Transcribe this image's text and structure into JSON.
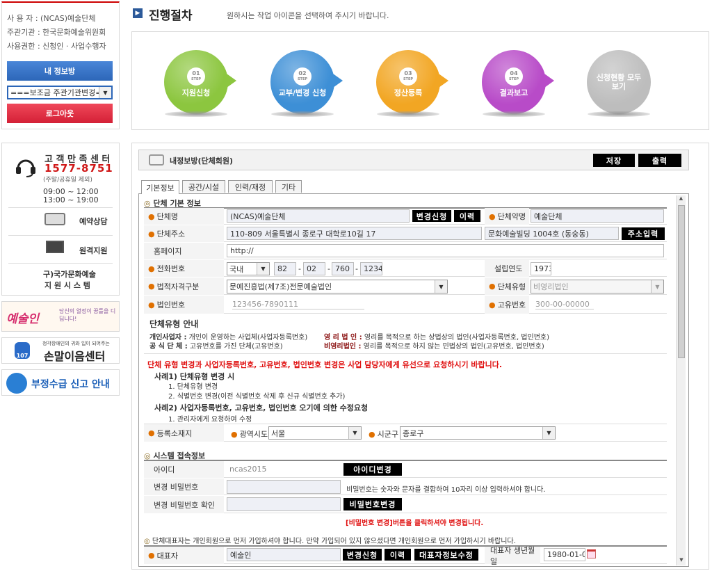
{
  "user": {
    "name_label": "사 용 자 : (NCAS)예술단체",
    "org_label": "주관기관 : 한국문화예술위원회",
    "role_label": "사용권한 : 신청인 · 사업수행자",
    "myinfo_btn": "내 정보방",
    "org_select": "===보조금 주관기관변경===",
    "logout_btn": "로그아웃"
  },
  "support": {
    "title": "고 객 만 족 센 터",
    "phone": "1577-8751",
    "note": "(주말/공휴일 제외)",
    "hours1": "09:00 ~ 12:00",
    "hours2": "13:00 ~ 19:00",
    "reserve": "예약상담",
    "remote": "원격지원",
    "old_sys_1": "구)국가문화예술",
    "old_sys_2": "지 원 시 스 템"
  },
  "banners": {
    "b1": "예술인",
    "b1_sub": "당신의 열정이 꿈틀을 디딥니다!",
    "b2_top": "청각장애인의 귀와 입이 되어주는",
    "b2": "손말이음센터",
    "b2_num": "107",
    "b3": "부정수급 신고 안내"
  },
  "header": {
    "title": "진행절차",
    "subtitle": "원하시는 작업 아이콘을 선택하여 주시기 바랍니다."
  },
  "steps": [
    {
      "num": "01",
      "step": "STEP",
      "label": "지원신청",
      "color": "#8cc63f"
    },
    {
      "num": "02",
      "step": "STEP",
      "label": "교부/변경 신청",
      "color": "#3d8fd6"
    },
    {
      "num": "03",
      "step": "STEP",
      "label": "정산등록",
      "color": "#f2a623"
    },
    {
      "num": "04",
      "step": "STEP",
      "label": "결과보고",
      "color": "#b84bc8"
    },
    {
      "label": "신청현황 모두보기",
      "color": "#bdbdbd"
    }
  ],
  "panel": {
    "title": "내정보방(단체회원)",
    "save": "저장",
    "print": "출력"
  },
  "tabs": [
    "기본정보",
    "공간/시설",
    "인력/재정",
    "기타"
  ],
  "section1": "단체 기본 정보",
  "form": {
    "name_lbl": "단체명",
    "name_val": "(NCAS)예술단체",
    "change_req": "변경신청",
    "history": "이력",
    "abbr_lbl": "단체약명",
    "abbr_val": "예술단체",
    "addr_lbl": "단체주소",
    "addr_val": "110-809  서울특별시 종로구 대학로10길 17",
    "addr2_val": "문화예술빌딩 1004호 (동숭동)",
    "addr_btn": "주소입력",
    "home_lbl": "홈페이지",
    "home_val": "http://",
    "tel_lbl": "전화번호",
    "tel_country": "국내",
    "tel1": "82",
    "tel2": "02",
    "tel3": "760",
    "tel4": "1234",
    "year_lbl": "설립연도",
    "year_val": "1973",
    "legal_lbl": "법적자격구분",
    "legal_val": "문예진흥법(제7조)전문예술법인",
    "type_lbl": "단체유형",
    "type_val": "비영리법인",
    "corp_lbl": "법인번호",
    "corp_ph": "123456-7890111",
    "uniq_lbl": "고유번호",
    "uniq_ph": "300-00-00000"
  },
  "guide": {
    "title": "단체유형 안내",
    "l1a": "개인사업자 :",
    "l1b": "개인이 운영하는 사업체(사업자등록번호)",
    "l1c": "영 리 법 인 :",
    "l1d": "영리를 목적으로 하는 상법상의 법인(사업자등록번호, 법인번호)",
    "l2a": "공 식 단 체 :",
    "l2b": "고유번호를 가진 단체(고유번호)",
    "l2c": "비영리법인 :",
    "l2d": "영리를 목적으로 하지 않는 민법상의 법인(고유번호, 법인번호)"
  },
  "notice": {
    "red": "단체 유형 변경과 사업자등록번호, 고유번호, 법인번호 변경은 사업 담당자에게 유선으로 요청하시기 바랍니다.",
    "c1": "사례1) 단체유형 변경 시",
    "c1a": "1. 단체유형 변경",
    "c1b": "2. 식별번호 변경(이전 식별번호 삭제 후 신규 식별번호 추가)",
    "c2": "사례2) 사업자등록번호, 고유번호, 법인번호 오기에 의한 수정요청",
    "c2a": "1. 관리자에게 요청하여 수정"
  },
  "region": {
    "lbl": "등록소재지",
    "sido_lbl": "광역시도",
    "sido": "서울",
    "gu_lbl": "시군구",
    "gu": "종로구"
  },
  "section2": "시스템 접속정보",
  "account": {
    "id_lbl": "아이디",
    "id_val": "ncas2015",
    "id_btn": "아이디변경",
    "pw_lbl": "변경 비밀번호",
    "pw_hint": "비밀번호는 숫자와 문자를 결합하여 10자리 이상 입력하셔야 합니다.",
    "pw2_lbl": "변경 비밀번호 확인",
    "pw_btn": "비밀번호변경",
    "pw_notice": "[비밀번호 변경]버튼을 클릭하셔야 변경됩니다."
  },
  "section3": "단체대표자는 개인회원으로 먼저 가입하셔야 합니다. 만약 가입되어 있지 않으셨다면 개인회원으로 먼저 가입하시기 바랍니다.",
  "rep": {
    "lbl": "대표자",
    "val": "예술인",
    "change": "변경신청",
    "history": "이력",
    "edit": "대표자정보수정",
    "birth_lbl": "대표자 생년월일",
    "birth_val": "1980-01-01"
  }
}
